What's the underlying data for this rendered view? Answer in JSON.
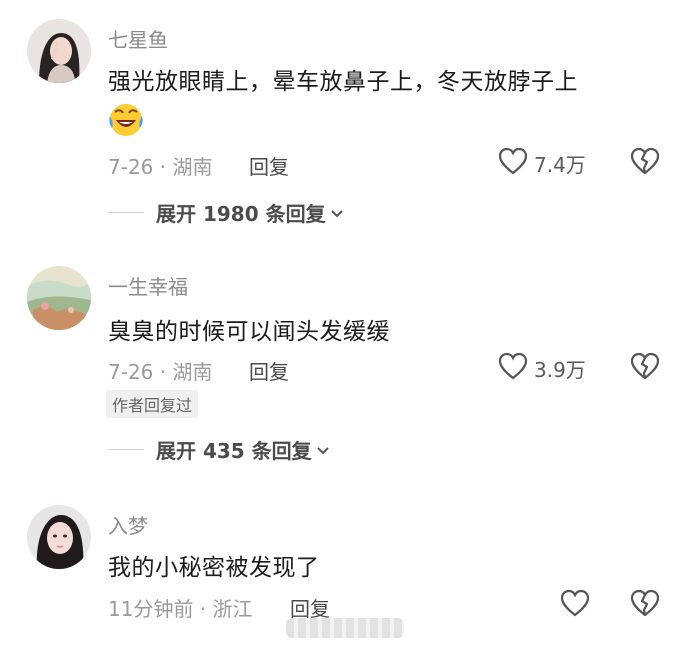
{
  "comments": [
    {
      "username": "七星鱼",
      "text": "强光放眼睛上，晕车放鼻子上，冬天放脖子上",
      "emoji": "laughing-crying-emoji",
      "date_location": "7-26 · 湖南",
      "reply_label": "回复",
      "likes": "7.4万",
      "expand_label": "展开 1980 条回复"
    },
    {
      "username": "一生幸福",
      "text": "臭臭的时候可以闻头发缓缓",
      "date_location": "7-26 · 湖南",
      "reply_label": "回复",
      "likes": "3.9万",
      "author_badge": "作者回复过",
      "expand_label": "展开 435 条回复"
    },
    {
      "username": "入梦",
      "text": "我的小秘密被发现了",
      "date_location": "11分钟前 · 浙江",
      "reply_label": "回复",
      "likes": ""
    }
  ],
  "icons": {
    "like": "heart-outline-icon",
    "dislike": "broken-heart-icon",
    "expand": "chevron-down-icon"
  }
}
